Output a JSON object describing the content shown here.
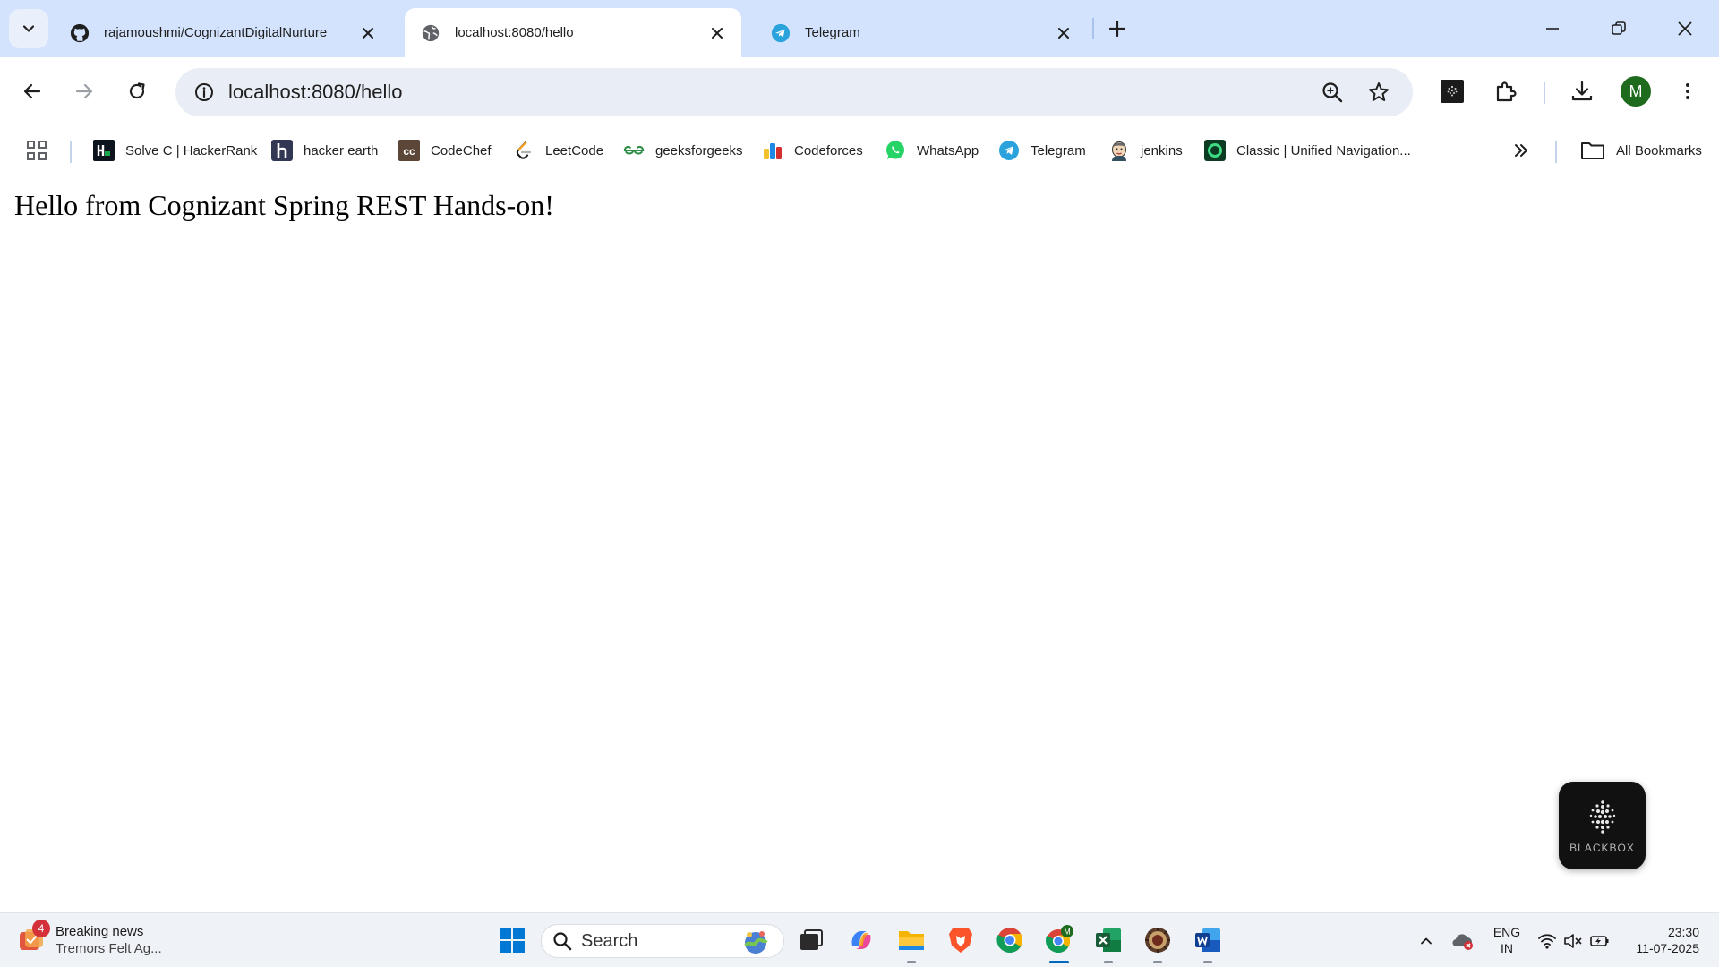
{
  "browser": {
    "tabs": [
      {
        "title": "rajamoushmi/CognizantDigitalNurture",
        "icon": "github-icon",
        "active": false
      },
      {
        "title": "localhost:8080/hello",
        "icon": "globe-icon",
        "active": true
      },
      {
        "title": "Telegram",
        "icon": "telegram-icon",
        "active": false
      }
    ],
    "address_bar": {
      "url": "localhost:8080/hello"
    },
    "profile_initial": "M"
  },
  "bookmarks": {
    "items": [
      {
        "label": "Solve C | HackerRank",
        "icon": "hackerrank-icon"
      },
      {
        "label": "hacker earth",
        "icon": "hackerearth-icon"
      },
      {
        "label": "CodeChef",
        "icon": "codechef-icon"
      },
      {
        "label": "LeetCode",
        "icon": "leetcode-icon"
      },
      {
        "label": "geeksforgeeks",
        "icon": "geeksforgeeks-icon"
      },
      {
        "label": "Codeforces",
        "icon": "codeforces-icon"
      },
      {
        "label": "WhatsApp",
        "icon": "whatsapp-icon"
      },
      {
        "label": "Telegram",
        "icon": "telegram-icon"
      },
      {
        "label": "jenkins",
        "icon": "jenkins-icon"
      },
      {
        "label": "Classic | Unified Navigation...",
        "icon": "unified-navigation-icon"
      }
    ],
    "all_bookmarks_label": "All Bookmarks"
  },
  "page": {
    "message": "Hello from Cognizant Spring REST Hands-on!"
  },
  "blackbox": {
    "label": "BLACKBOX"
  },
  "taskbar": {
    "news": {
      "badge": "4",
      "headline": "Breaking news",
      "subtext": "Tremors Felt Ag..."
    },
    "search_label": "Search",
    "language": {
      "line1": "ENG",
      "line2": "IN"
    },
    "clock": {
      "time": "23:30",
      "date": "11-07-2025"
    }
  },
  "colors": {
    "tab_strip": "#d3e3fd",
    "omnibox": "#e9eef6",
    "avatar": "#1e6b1e",
    "taskbar": "#eff2f7",
    "accent": "#0067c0"
  }
}
